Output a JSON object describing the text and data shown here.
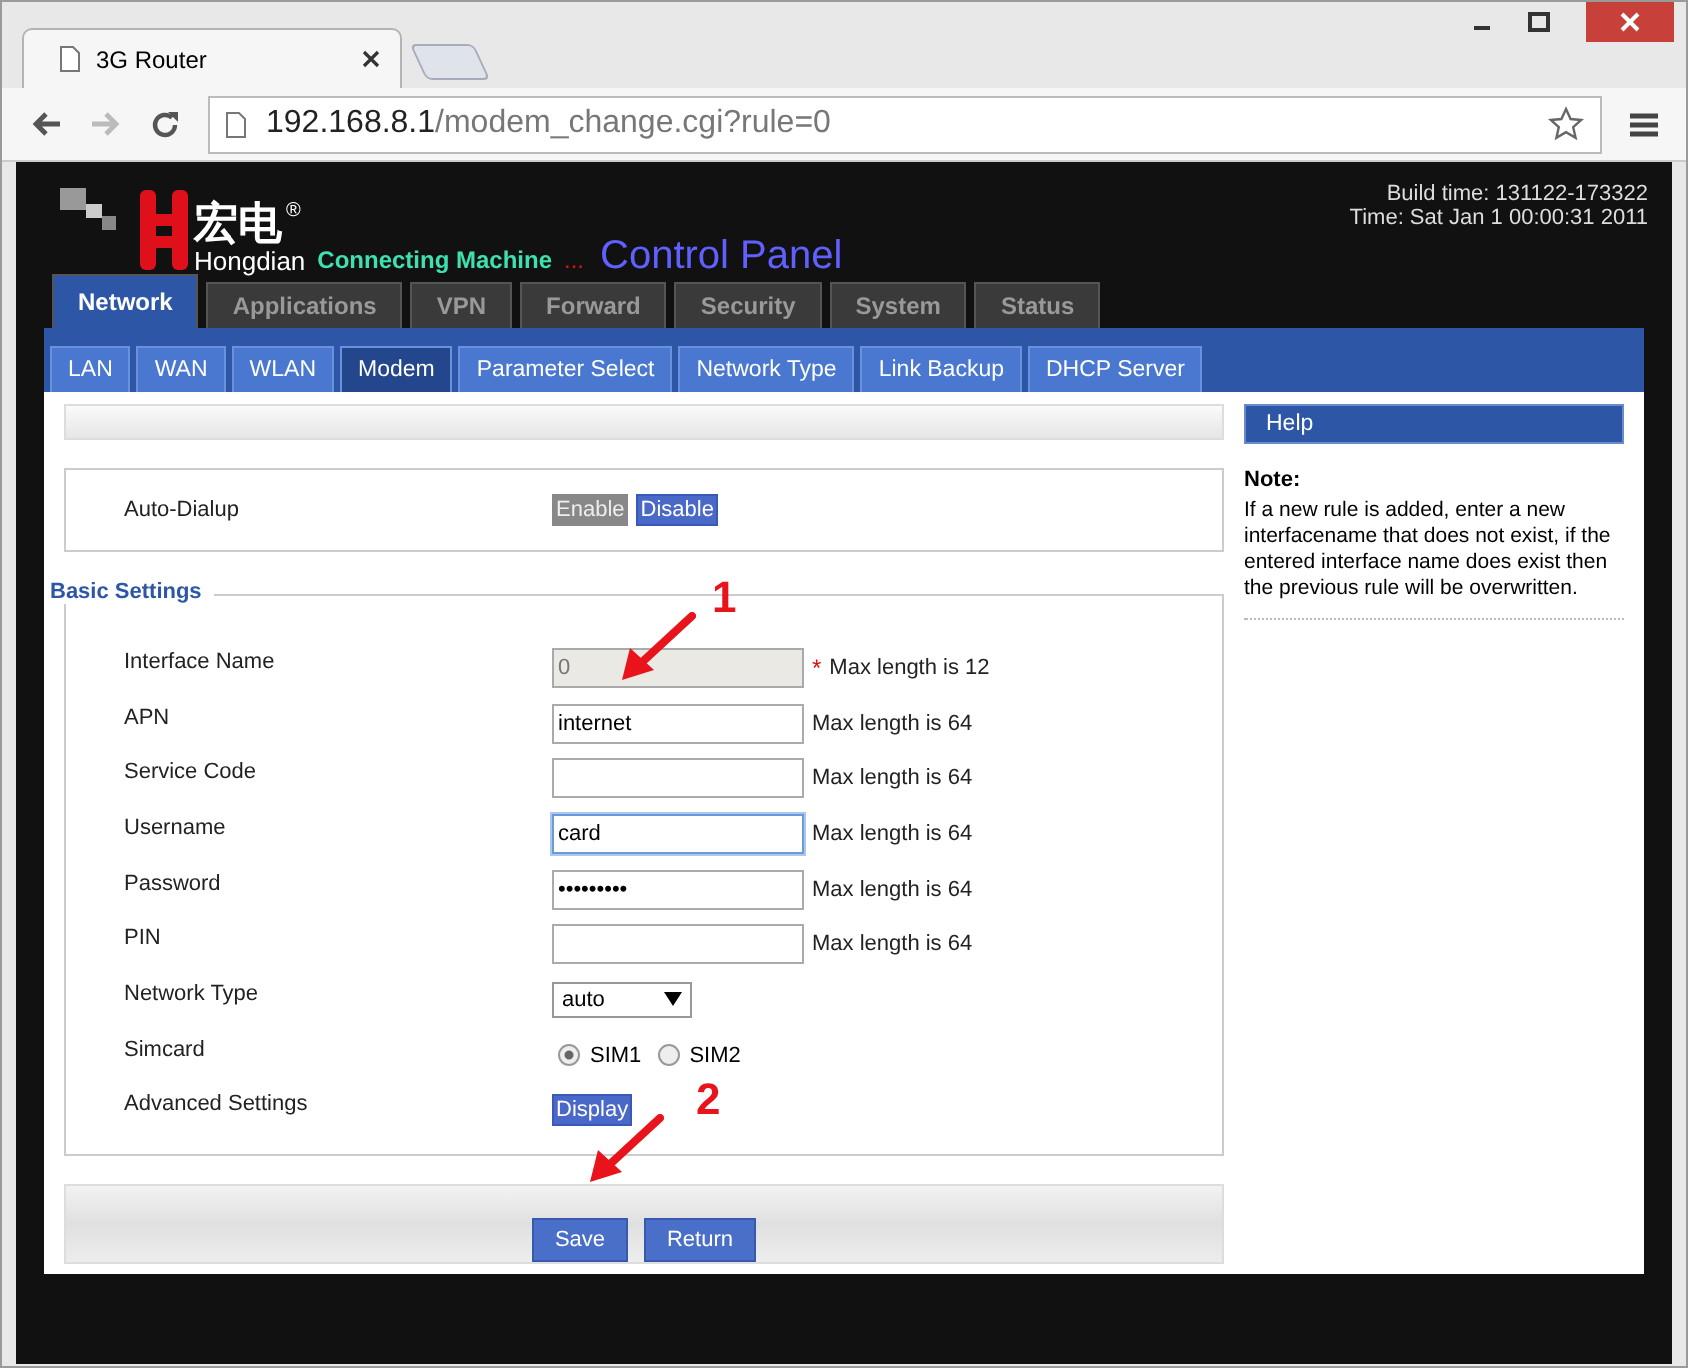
{
  "browser": {
    "tab_title": "3G Router",
    "url_host": "192.168.8.1",
    "url_path": "/modem_change.cgi?rule=0"
  },
  "header": {
    "brand_cn": "宏电",
    "registered": "®",
    "brand_en": "Hongdian",
    "tagline": "Connecting Machine",
    "dots": "...",
    "title": "Control Panel",
    "build_time": "Build time: 131122-173322",
    "time": "Time: Sat Jan 1 00:00:31 2011"
  },
  "main_tabs": [
    {
      "label": "Network",
      "selected": true
    },
    {
      "label": "Applications",
      "selected": false
    },
    {
      "label": "VPN",
      "selected": false
    },
    {
      "label": "Forward",
      "selected": false
    },
    {
      "label": "Security",
      "selected": false
    },
    {
      "label": "System",
      "selected": false
    },
    {
      "label": "Status",
      "selected": false
    }
  ],
  "sub_tabs": [
    {
      "label": "LAN",
      "selected": false
    },
    {
      "label": "WAN",
      "selected": false
    },
    {
      "label": "WLAN",
      "selected": false
    },
    {
      "label": "Modem",
      "selected": true
    },
    {
      "label": "Parameter Select",
      "selected": false
    },
    {
      "label": "Network Type",
      "selected": false
    },
    {
      "label": "Link Backup",
      "selected": false
    },
    {
      "label": "DHCP Server",
      "selected": false
    }
  ],
  "auto_dialup": {
    "label": "Auto-Dialup",
    "options": [
      {
        "label": "Enable",
        "selected": false
      },
      {
        "label": "Disable",
        "selected": true
      }
    ]
  },
  "basic_settings": {
    "legend": "Basic Settings",
    "rows": [
      {
        "kind": "text",
        "label": "Interface Name",
        "value": "0",
        "disabled": true,
        "required_mark": "*",
        "hint": "Max length is 12"
      },
      {
        "kind": "text",
        "label": "APN",
        "value": "internet",
        "disabled": false,
        "hint": "Max length is 64"
      },
      {
        "kind": "text",
        "label": "Service Code",
        "value": "",
        "disabled": false,
        "hint": "Max length is 64"
      },
      {
        "kind": "text",
        "label": "Username",
        "value": "card",
        "disabled": false,
        "focused": true,
        "hint": "Max length is 64"
      },
      {
        "kind": "text",
        "label": "Password",
        "value": "•••••••••",
        "disabled": false,
        "hint": "Max length is 64"
      },
      {
        "kind": "text",
        "label": "PIN",
        "value": "",
        "disabled": false,
        "hint": "Max length is 64"
      },
      {
        "kind": "select",
        "label": "Network Type",
        "value": "auto"
      },
      {
        "kind": "radio",
        "label": "Simcard",
        "options": [
          {
            "label": "SIM1",
            "selected": true
          },
          {
            "label": "SIM2",
            "selected": false
          }
        ]
      },
      {
        "kind": "button",
        "label": "Advanced Settings",
        "button": "Display"
      }
    ]
  },
  "buttons": [
    "Save",
    "Return"
  ],
  "help": {
    "title": "Help",
    "note_title": "Note:",
    "note": "If a new rule is added, enter a new interfacename that does not exist, if the entered interface name does exist then the previous rule will be overwritten."
  },
  "annotations": [
    {
      "label": "1"
    },
    {
      "label": "2"
    }
  ]
}
